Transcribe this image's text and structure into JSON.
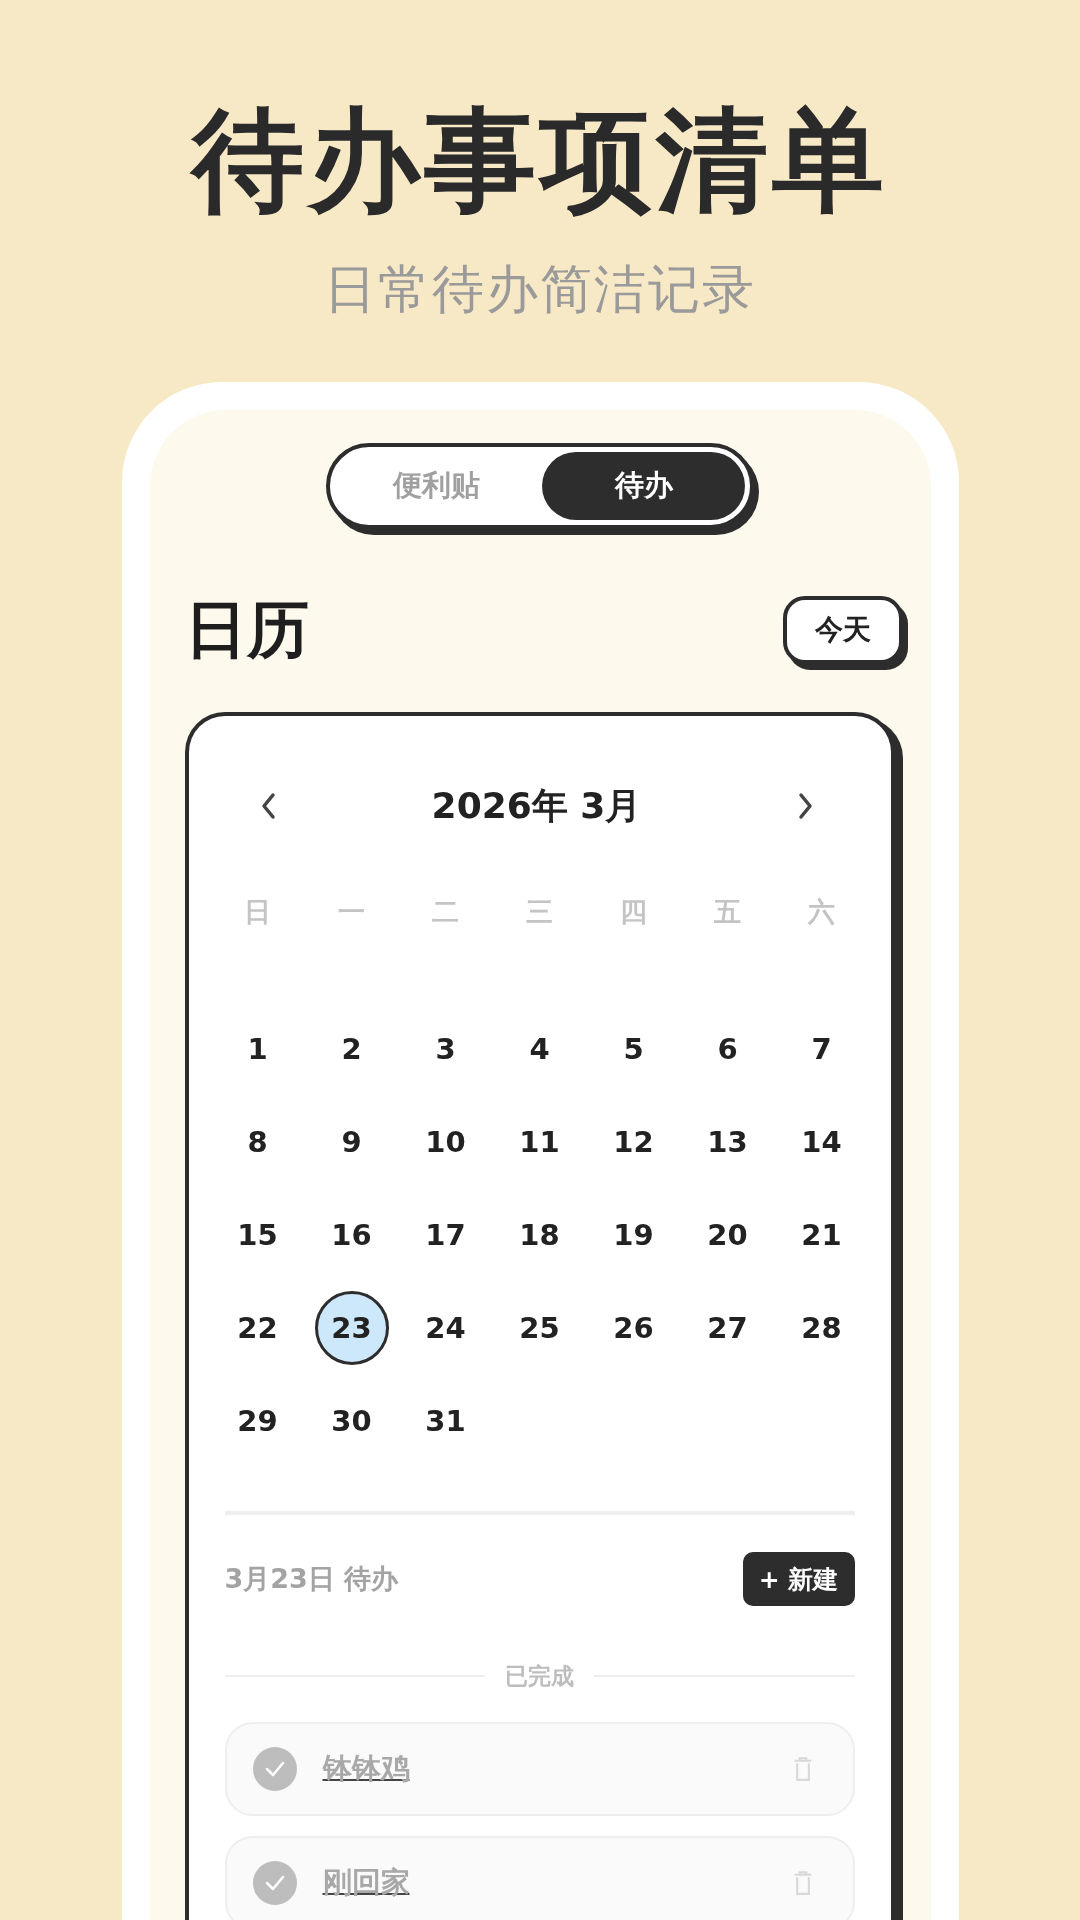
{
  "promo": {
    "title": "待办事项清单",
    "subtitle": "日常待办简洁记录"
  },
  "tabs": [
    {
      "label": "便利贴",
      "selected": false
    },
    {
      "label": "待办",
      "selected": true
    }
  ],
  "heading": "日历",
  "today_button": "今天",
  "calendar": {
    "month_label": "2026年 3月",
    "weekdays": [
      "日",
      "一",
      "二",
      "三",
      "四",
      "五",
      "六"
    ],
    "days": [
      {
        "label": "1",
        "selected": false
      },
      {
        "label": "2",
        "selected": false
      },
      {
        "label": "3",
        "selected": false
      },
      {
        "label": "4",
        "selected": false
      },
      {
        "label": "5",
        "selected": false
      },
      {
        "label": "6",
        "selected": false
      },
      {
        "label": "7",
        "selected": false
      },
      {
        "label": "8",
        "selected": false
      },
      {
        "label": "9",
        "selected": false
      },
      {
        "label": "10",
        "selected": false
      },
      {
        "label": "11",
        "selected": false
      },
      {
        "label": "12",
        "selected": false
      },
      {
        "label": "13",
        "selected": false
      },
      {
        "label": "14",
        "selected": false
      },
      {
        "label": "15",
        "selected": false
      },
      {
        "label": "16",
        "selected": false
      },
      {
        "label": "17",
        "selected": false
      },
      {
        "label": "18",
        "selected": false
      },
      {
        "label": "19",
        "selected": false
      },
      {
        "label": "20",
        "selected": false
      },
      {
        "label": "21",
        "selected": false
      },
      {
        "label": "22",
        "selected": false
      },
      {
        "label": "23",
        "selected": true
      },
      {
        "label": "24",
        "selected": false
      },
      {
        "label": "25",
        "selected": false
      },
      {
        "label": "26",
        "selected": false
      },
      {
        "label": "27",
        "selected": false
      },
      {
        "label": "28",
        "selected": false
      },
      {
        "label": "29",
        "selected": false
      },
      {
        "label": "30",
        "selected": false
      },
      {
        "label": "31",
        "selected": false
      }
    ]
  },
  "todo_header": {
    "date_label": "3月23日 待办",
    "new_button": "+ 新建"
  },
  "completed_label": "已完成",
  "todos": [
    {
      "text": "钵钵鸡",
      "done": true
    },
    {
      "text": "刚回家",
      "done": true
    }
  ]
}
